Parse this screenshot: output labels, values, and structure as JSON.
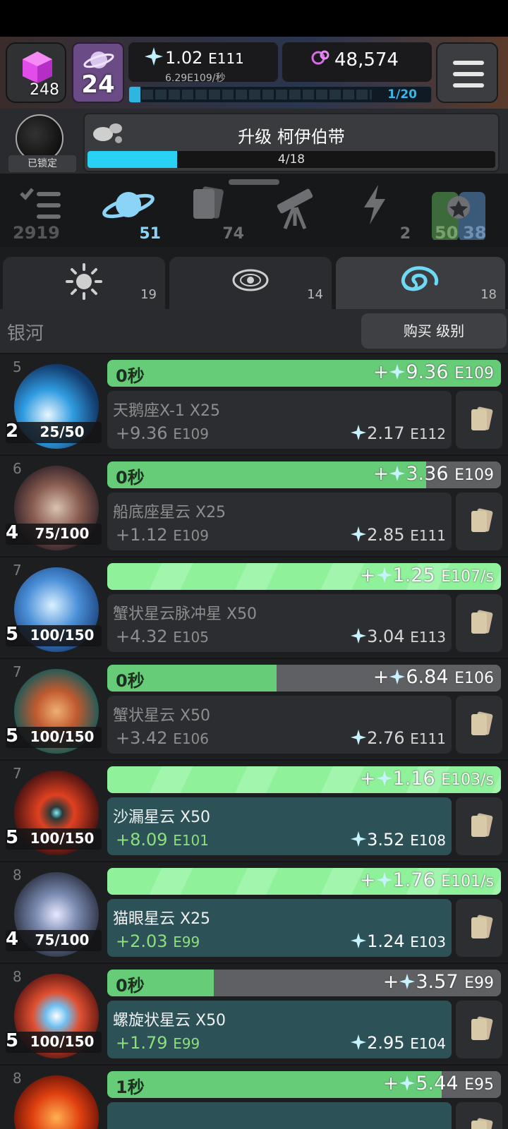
{
  "hud": {
    "gems": "248",
    "level": "24",
    "stardust": {
      "value": "1.02",
      "exp": "E111",
      "rate": "6.29E109/秒"
    },
    "dark_matter": "48,574",
    "progress_label": "1/20"
  },
  "upgrade": {
    "locked_label": "已锁定",
    "title": "升级 柯伊伯带",
    "count": "4/18",
    "progress": 0.22
  },
  "main_tabs": [
    {
      "name": "tasks",
      "count": "2919"
    },
    {
      "name": "planets",
      "count": "51"
    },
    {
      "name": "cards",
      "count": "74"
    },
    {
      "name": "telescope",
      "count": ""
    },
    {
      "name": "boosts",
      "count": "2"
    },
    {
      "name": "rewards",
      "count": "50",
      "count2": "38"
    }
  ],
  "sub_tabs": [
    {
      "name": "stars",
      "count": "19"
    },
    {
      "name": "systems",
      "count": "14"
    },
    {
      "name": "galaxy",
      "count": "18"
    }
  ],
  "section": {
    "title": "银河",
    "buy_label": "购买 级别"
  },
  "items": [
    {
      "num": "5",
      "level": "2",
      "progress": "25/50",
      "timer": "0秒",
      "fill": 1.0,
      "mode": "timer",
      "value": "+",
      "value_num": "9.36",
      "value_exp": "E109",
      "name": "天鹅座X-1  X25",
      "income": "+9.36",
      "income_exp": "E109",
      "cost": "2.17",
      "cost_exp": "E112",
      "owned": false
    },
    {
      "num": "6",
      "level": "4",
      "progress": "75/100",
      "timer": "0秒",
      "fill": 0.81,
      "mode": "timer",
      "value": "+",
      "value_num": "3.36",
      "value_exp": "E109",
      "name": "船底座星云  X25",
      "income": "+1.12",
      "income_exp": "E109",
      "cost": "2.85",
      "cost_exp": "E111",
      "owned": false
    },
    {
      "num": "7",
      "level": "5",
      "progress": "100/150",
      "timer": "",
      "fill": 1.0,
      "mode": "rate",
      "value": "+",
      "value_num": "1.25",
      "value_exp": "E107/s",
      "name": "蟹状星云脉冲星  X50",
      "income": "+4.32",
      "income_exp": "E105",
      "cost": "3.04",
      "cost_exp": "E113",
      "owned": false
    },
    {
      "num": "7",
      "level": "5",
      "progress": "100/150",
      "timer": "0秒",
      "fill": 0.43,
      "mode": "timer",
      "value": "+",
      "value_num": "6.84",
      "value_exp": "E106",
      "name": "蟹状星云  X50",
      "income": "+3.42",
      "income_exp": "E106",
      "cost": "2.76",
      "cost_exp": "E111",
      "owned": false
    },
    {
      "num": "7",
      "level": "5",
      "progress": "100/150",
      "timer": "",
      "fill": 1.0,
      "mode": "rate",
      "value": "+",
      "value_num": "1.16",
      "value_exp": "E103/s",
      "name": "沙漏星云  X50",
      "income": "+8.09",
      "income_exp": "E101",
      "cost": "3.52",
      "cost_exp": "E108",
      "owned": true
    },
    {
      "num": "8",
      "level": "4",
      "progress": "75/100",
      "timer": "",
      "fill": 1.0,
      "mode": "rate",
      "value": "+",
      "value_num": "1.76",
      "value_exp": "E101/s",
      "name": "猫眼星云  X25",
      "income": "+2.03",
      "income_exp": "E99",
      "cost": "1.24",
      "cost_exp": "E103",
      "owned": true
    },
    {
      "num": "8",
      "level": "5",
      "progress": "100/150",
      "timer": "0秒",
      "fill": 0.27,
      "mode": "timer",
      "value": "+",
      "value_num": "3.57",
      "value_exp": "E99",
      "name": "螺旋状星云  X50",
      "income": "+1.79",
      "income_exp": "E99",
      "cost": "2.95",
      "cost_exp": "E104",
      "owned": true
    },
    {
      "num": "8",
      "level": "",
      "progress": "",
      "timer": "1秒",
      "fill": 0.85,
      "mode": "timer",
      "value": "+",
      "value_num": "5.44",
      "value_exp": "E95",
      "name": "",
      "income": "",
      "income_exp": "",
      "cost": "",
      "cost_exp": "",
      "owned": true
    }
  ],
  "colors": {
    "accent": "#29d2f4",
    "green_bar": "#66cc77",
    "owned_card": "#2c5257"
  },
  "icons": [
    "gem-icon",
    "planet-icon",
    "sparkle-icon",
    "dark-matter-icon",
    "menu-icon",
    "lock-icon",
    "asteroid-icon",
    "tasks-icon",
    "saturn-icon",
    "cards-icon",
    "telescope-icon",
    "lightning-icon",
    "award-icon",
    "sun-icon",
    "solar-system-icon",
    "galaxy-icon",
    "card-stack-icon"
  ]
}
